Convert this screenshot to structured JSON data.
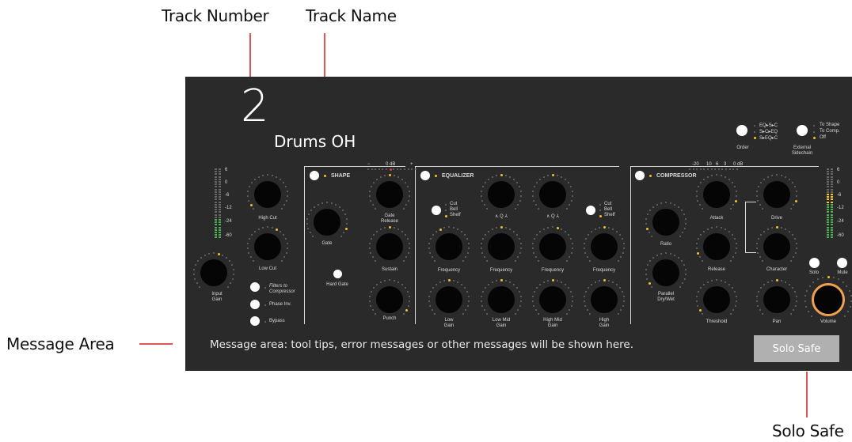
{
  "callouts": {
    "track_number": "Track Number",
    "track_name": "Track Name",
    "message_area": "Message Area",
    "solo_safe": "Solo Safe"
  },
  "track": {
    "number": "2",
    "name": "Drums OH"
  },
  "sections": {
    "shape": "SHAPE",
    "equalizer": "EQUALIZER",
    "compressor": "COMPRESSOR"
  },
  "order": {
    "label": "Order",
    "options": [
      "EQ▸S▸C",
      "S▸C▸EQ",
      "S▸EQ▸C"
    ],
    "selected": 2
  },
  "sidechain": {
    "label": "External Sidechain",
    "options": [
      "To Shape",
      "To Comp.",
      "Off"
    ],
    "selected": 2
  },
  "meters": {
    "scale": [
      "6",
      "0",
      "-6",
      "-12",
      "-24",
      "-60"
    ]
  },
  "shape_scale": {
    "minus": "−",
    "zero": "0 dB",
    "plus": "+"
  },
  "comp_scale": [
    "-20",
    "10",
    "6",
    "3",
    "0 dB"
  ],
  "knobs": {
    "input_gain": "Input Gain",
    "high_cut": "High Cut",
    "low_cut": "Low Cut",
    "gate": "Gate",
    "gate_release": "Gate Release",
    "sustain": "Sustain",
    "punch": "Punch",
    "hard_gate": "Hard Gate",
    "eq_freq1": "Frequency",
    "eq_freq2": "Frequency",
    "eq_freq3": "Frequency",
    "eq_freq4": "Frequency",
    "low_gain": "Low Gain",
    "low_mid_gain": "Low Mid Gain",
    "high_mid_gain": "High Mid Gain",
    "high_gain": "High Gain",
    "ratio": "Ratio",
    "parallel": "Parallel Dry/Wet",
    "attack": "Attack",
    "release": "Release",
    "threshold": "Threshold",
    "drive": "Drive",
    "character": "Character",
    "pan": "Pan",
    "volume": "Volume"
  },
  "eq_band_types": [
    "Cut",
    "Bell",
    "Shelf"
  ],
  "eq_q": "∧ Q ⅄",
  "toggles": {
    "filters": "Filters to Compressor",
    "phase": "Phase Inv.",
    "bypass": "Bypass",
    "solo": "Solo",
    "mute": "Mute"
  },
  "message": "Message area: tool tips, error messages or other messages will be shown here.",
  "solo_safe_button": "Solo Safe",
  "colors": {
    "panel": "#2a2a2a",
    "accent": "#f2c230",
    "volume_ring": "#f0a050",
    "callout_line": "#e05555"
  }
}
